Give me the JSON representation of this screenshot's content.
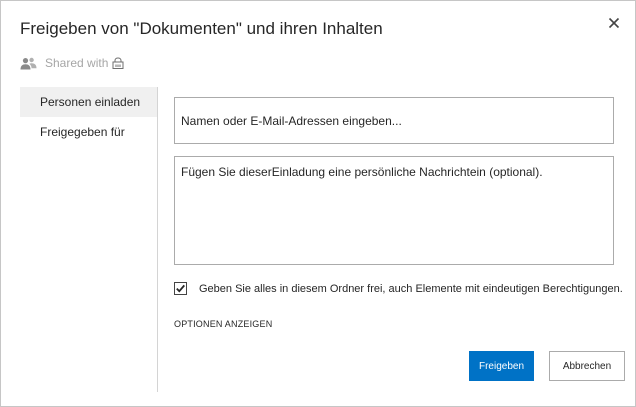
{
  "dialog": {
    "title": "Freigeben von \"Dokumenten\" und ihren Inhalten",
    "close_icon": "close-icon",
    "shared_with": {
      "icon": "people-icon",
      "label": "Shared with",
      "suffix_icon": "lock-icon"
    }
  },
  "sidebar": {
    "items": [
      {
        "label": "Personen einladen",
        "selected": true
      },
      {
        "label": "Freigegeben für",
        "selected": false
      }
    ]
  },
  "form": {
    "names_placeholder": "Namen oder E-Mail-Adressen eingeben...",
    "names_value": "",
    "message_placeholder": "Fügen Sie dieserEinladung eine persönliche Nachrichtein (optional).",
    "message_value": "",
    "share_all_checked": true,
    "share_all_label": "Geben Sie alles in diesem Ordner frei, auch Elemente mit eindeutigen Berechtigungen.",
    "options_link": "OPTIONEN ANZEIGEN"
  },
  "buttons": {
    "share_label": "Freigeben",
    "cancel_label": "Abbrechen"
  },
  "colors": {
    "accent": "#0072c6",
    "border": "#ababab",
    "selected_bg": "#f0f0f0",
    "muted_text": "#a6a6a6"
  }
}
